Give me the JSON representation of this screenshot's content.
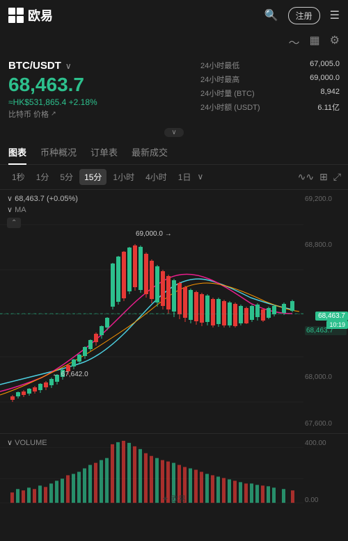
{
  "header": {
    "logo_text": "欧易",
    "register_btn": "注册",
    "icons": [
      "search",
      "register",
      "menu"
    ]
  },
  "toolbar": {
    "icons": [
      "wave-icon",
      "document-icon",
      "gear-icon"
    ]
  },
  "price_section": {
    "pair": "BTC/USDT",
    "pair_arrow": "∨",
    "main_price": "68,463.7",
    "hk_price": "≈HK$531,865.4 +2.18%",
    "btc_label": "比特币 价格",
    "stats": [
      {
        "label": "24小时最低",
        "value": "67,005.0"
      },
      {
        "label": "24小时最高",
        "value": "69,000.0"
      },
      {
        "label": "24小时量 (BTC)",
        "value": "8,942"
      },
      {
        "label": "24小时额 (USDT)",
        "value": "6.11亿"
      }
    ]
  },
  "tabs": [
    {
      "label": "图表",
      "active": true
    },
    {
      "label": "币种概况",
      "active": false
    },
    {
      "label": "订单表",
      "active": false
    },
    {
      "label": "最新成交",
      "active": false
    }
  ],
  "intervals": [
    {
      "label": "1秒",
      "active": false
    },
    {
      "label": "1分",
      "active": false
    },
    {
      "label": "5分",
      "active": false
    },
    {
      "label": "15分",
      "active": true
    },
    {
      "label": "1小时",
      "active": false
    },
    {
      "label": "4小时",
      "active": false
    },
    {
      "label": "1日",
      "active": false
    }
  ],
  "chart": {
    "current_price": "68,463.7",
    "current_time": "10:19",
    "price_info": "68,463.7 (+0.05%)",
    "ma_label": "MA",
    "annotation_high": "69,000.0 →",
    "annotation_low": "← 67,642.0",
    "y_axis": [
      "69,200.0",
      "68,800.0",
      "",
      "68,463.7",
      "68,000.0",
      "67,600.0"
    ],
    "current_price_top_pct": 52
  },
  "volume": {
    "label": "VOLUME",
    "y_axis": [
      "400.00",
      "",
      "0.00"
    ]
  },
  "watermark": "✦ 欧易"
}
